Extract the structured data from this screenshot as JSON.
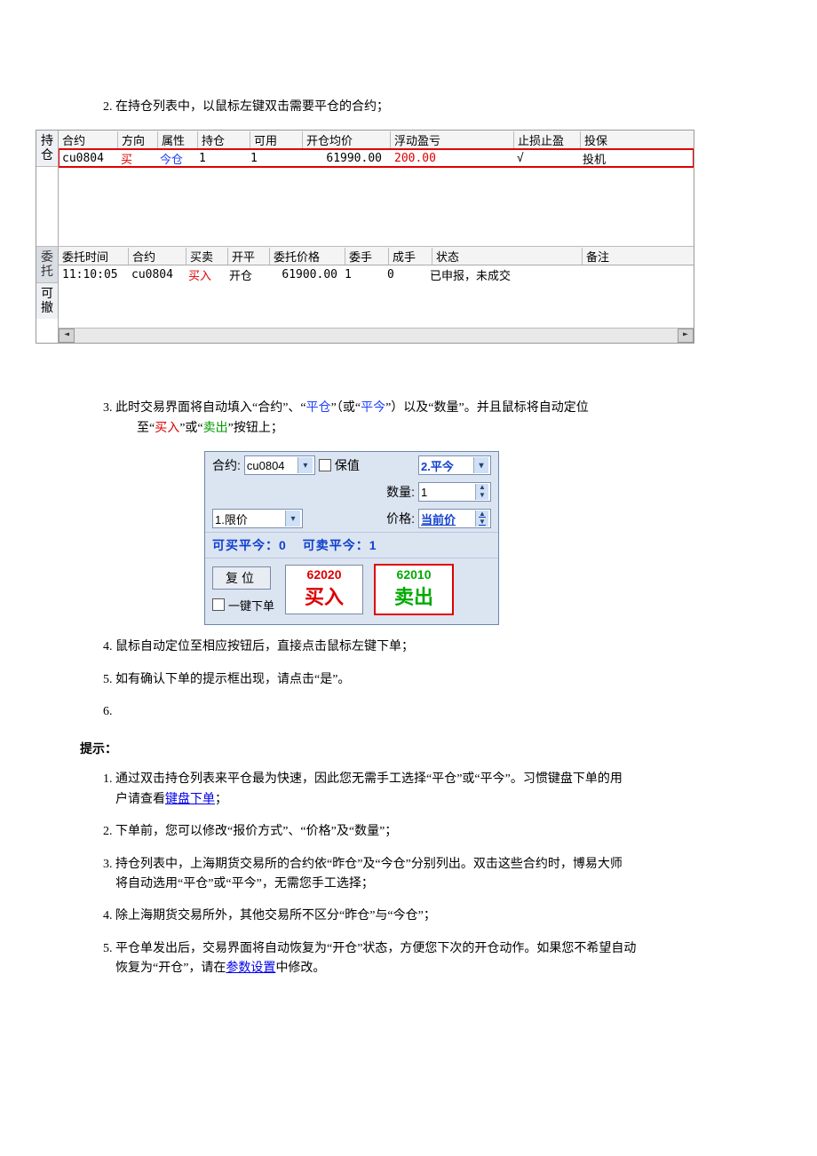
{
  "steps2": "在持仓列表中，以鼠标左键双击需要平仓的合约；",
  "positions": {
    "tab_active": "持仓",
    "headers": [
      "合约",
      "方向",
      "属性",
      "持仓",
      "可用",
      "开仓均价",
      "浮动盈亏",
      "止损止盈",
      "投保"
    ],
    "row": {
      "contract": "cu0804",
      "dir": "买",
      "attr": "今仓",
      "pos": "1",
      "avail": "1",
      "avg": "61990.00",
      "pnl": "200.00",
      "stop": "√",
      "hedge": "投机"
    }
  },
  "orders": {
    "tab1": "委托",
    "tab2": "可撤",
    "headers": [
      "委托时间",
      "合约",
      "买卖",
      "开平",
      "委托价格",
      "委手",
      "成手",
      "状态",
      "备注"
    ],
    "row": {
      "time": "11:10:05",
      "contract": "cu0804",
      "bs": "买入",
      "oc": "开仓",
      "price": "61900.00",
      "ord": "1",
      "fill": "0",
      "status": "已申报，未成交"
    }
  },
  "step3": {
    "pre": "此时交易界面将自动填入“合约”、“",
    "w1": "平仓",
    "mid": "”（或“",
    "w2": "平今",
    "suf": "”）以及“数量”。并且鼠标将自动定位",
    "line2_pre": "至“",
    "line2_buy": "买入",
    "line2_mid": "”或“",
    "line2_sell": "卖出",
    "line2_suf": "”按钮上；"
  },
  "entry": {
    "lbl_contract": "合约:",
    "contract": "cu0804",
    "hedge": "保值",
    "oc": "2.平今",
    "lbl_qty": "数量:",
    "qty": "1",
    "price_type": "1.限价",
    "lbl_price": "价格:",
    "price_val": "当前价",
    "avail_line_a": "可买平今：0",
    "avail_line_b": "可卖平今：1",
    "reset": "复位",
    "oneclick": "一键下单",
    "buy_price": "62020",
    "buy": "买入",
    "sell_price": "62010",
    "sell": "卖出"
  },
  "step4": "鼠标自动定位至相应按钮后，直接点击鼠标左键下单；",
  "step5": "如有确认下单的提示框出现，请点击“是”。",
  "tips_title": "提示：",
  "tips": {
    "t1a": "通过双击持仓列表来平仓最为快速，因此您无需手工选择“平仓”或“平今”。习惯键盘下单的用",
    "t1b": "户请查看",
    "t1link": "键盘下单",
    "t1c": "；",
    "t2": "下单前，您可以修改“报价方式”、“价格”及“数量”；",
    "t3a": "持仓列表中，上海期货交易所的合约依“昨仓”及“今仓”分别列出。双击这些合约时，博易大师",
    "t3b": "将自动选用“平仓”或“平今”，无需您手工选择；",
    "t4": "除上海期货交易所外，其他交易所不区分“昨仓”与“今仓”；",
    "t5a": "平仓单发出后，交易界面将自动恢复为“开仓”状态，方便您下次的开仓动作。如果您不希望自动",
    "t5b_pre": "恢复为“开仓”，请在",
    "t5link": "参数设置",
    "t5b_suf": "中修改。"
  }
}
